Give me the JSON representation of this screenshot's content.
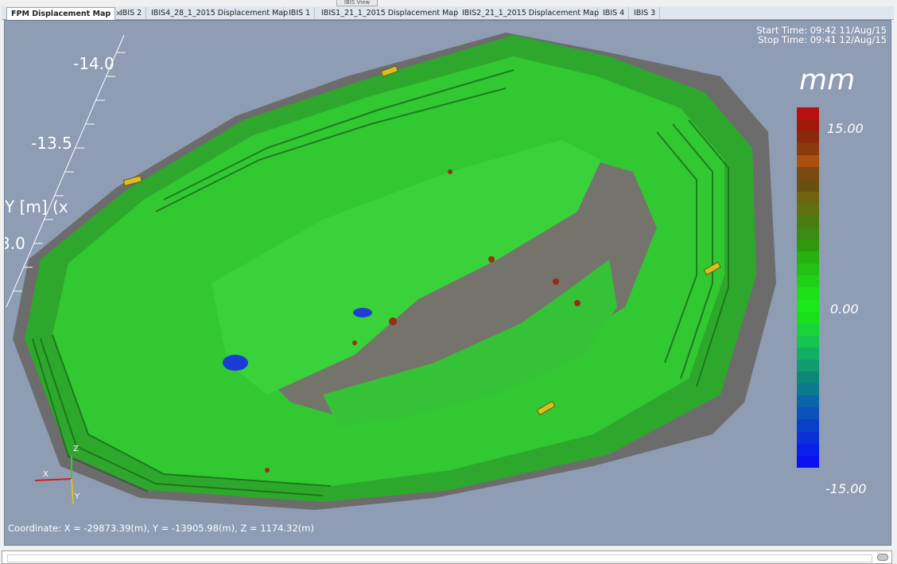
{
  "window": {
    "caption": "IBIS View"
  },
  "tabs": [
    {
      "label": "FPM Displacement Map",
      "active": true,
      "closable": true
    },
    {
      "label": "IBIS 2"
    },
    {
      "label": "IBIS4_28_1_2015 Displacement Map"
    },
    {
      "label": "IBIS 1"
    },
    {
      "label": "IBIS1_21_1_2015 Displacement Map"
    },
    {
      "label": "IBIS2_21_1_2015 Displacement Map"
    },
    {
      "label": "IBIS 4"
    },
    {
      "label": "IBIS 3"
    }
  ],
  "tab_close_icon": "close-icon",
  "viewport": {
    "start_time": "Start Time: 09:42 11/Aug/15",
    "stop_time": "Stop Time: 09:41 12/Aug/15",
    "axis_labels": {
      "tick_top": "-14.0",
      "tick_mid": "-13.5",
      "axis_name": "Y [m] (x",
      "tick_low": "3.0"
    },
    "coordinate": "Coordinate: X = -29873.39(m), Y = -13905.98(m), Z = 1174.32(m)",
    "gizmo": {
      "z": "Z",
      "x": "X",
      "y": "Y"
    }
  },
  "legend": {
    "unit": "mm",
    "max_label": "15.00",
    "mid_label": "0.00",
    "min_label": "-15.00",
    "colors": [
      "#b81010",
      "#a01a0a",
      "#8a2a0c",
      "#8c3a0c",
      "#a8500c",
      "#7a4a10",
      "#6a5010",
      "#6e6410",
      "#5e7010",
      "#4a7c12",
      "#3c8a12",
      "#30980c",
      "#27b010",
      "#22c012",
      "#20d015",
      "#1ee018",
      "#1ae81a",
      "#18e018",
      "#18d43a",
      "#16c450",
      "#12b064",
      "#0e9c70",
      "#0c8878",
      "#0a7a8c",
      "#0a66a8",
      "#0a52b8",
      "#0a40c8",
      "#0a30d8",
      "#0820e8",
      "#0a10f0"
    ]
  }
}
